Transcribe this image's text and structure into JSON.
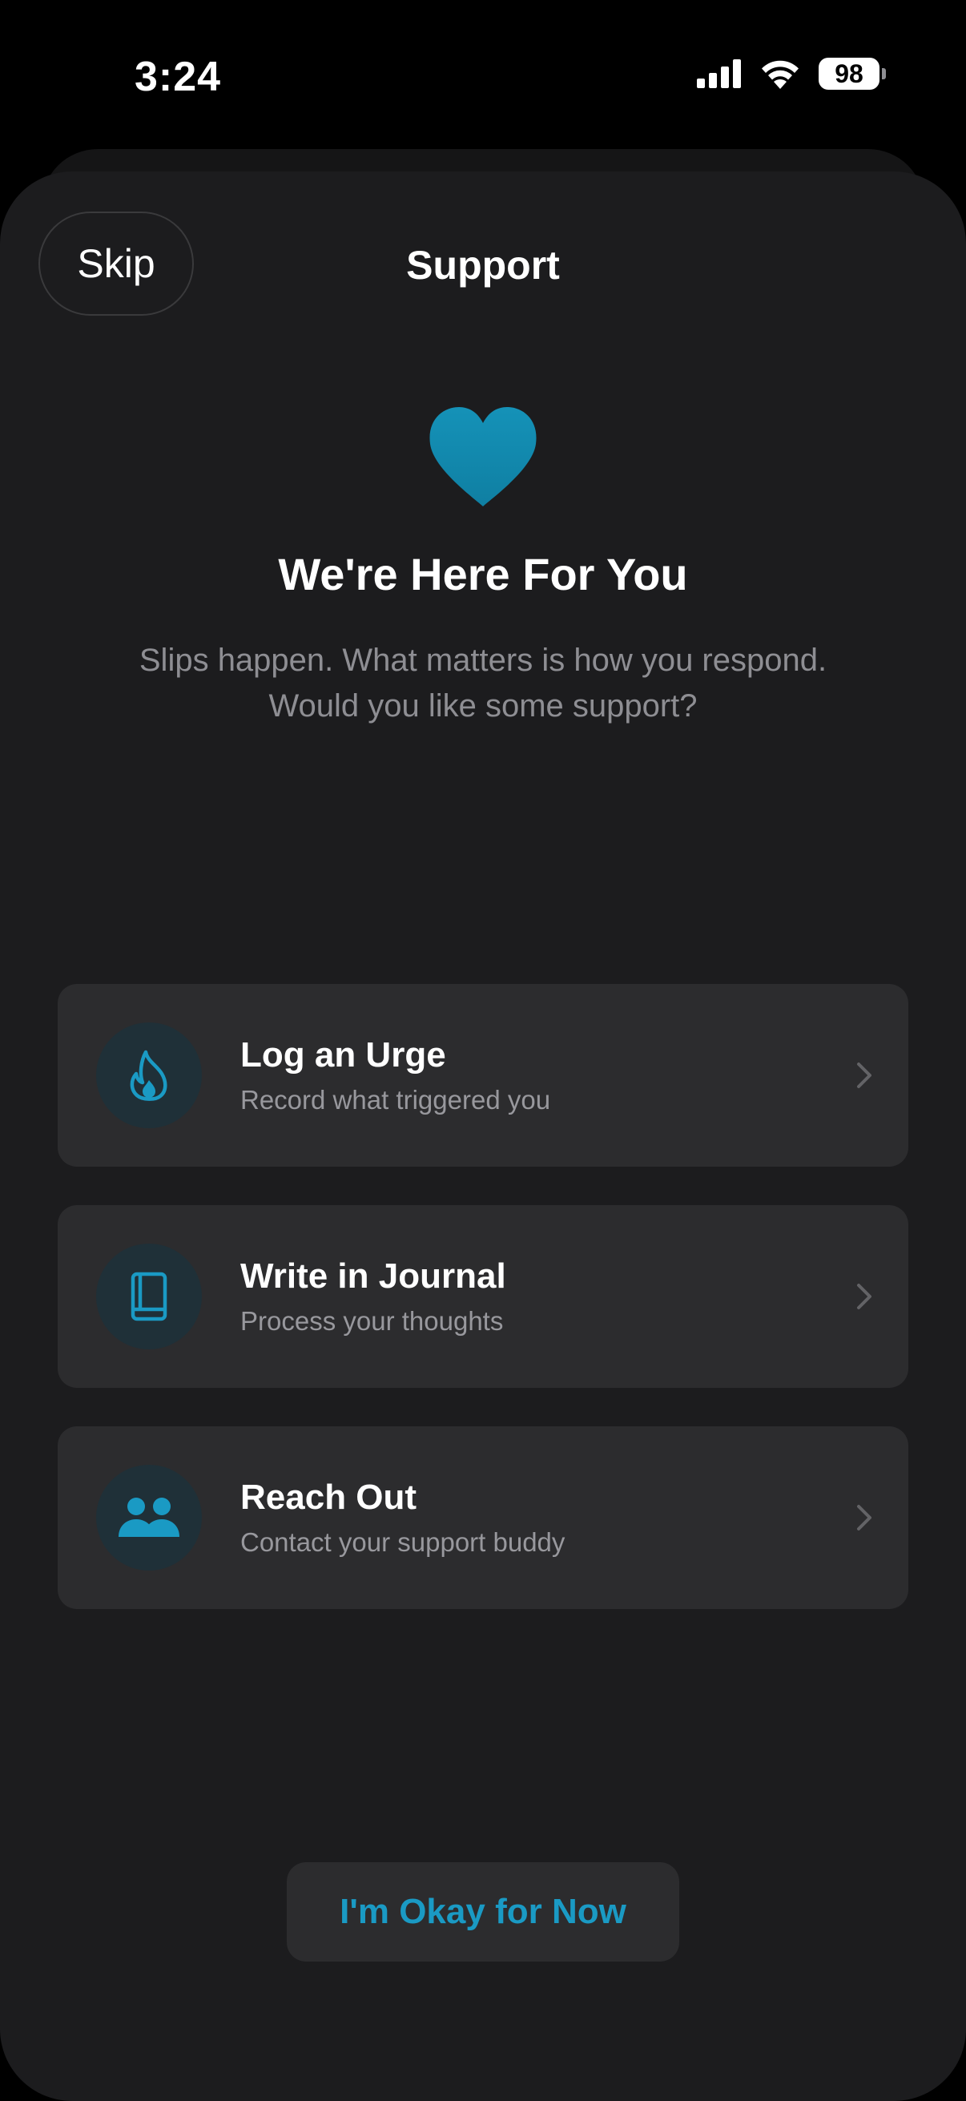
{
  "status_bar": {
    "time": "3:24",
    "battery": "98",
    "icons": [
      "signal-icon",
      "wifi-icon",
      "battery-icon"
    ]
  },
  "header": {
    "skip_label": "Skip",
    "title": "Support"
  },
  "hero": {
    "icon": "heart-icon",
    "headline": "We're Here For You",
    "subtext_line1": "Slips happen. What matters is how you respond.",
    "subtext_line2": "Would you like some support?"
  },
  "options": [
    {
      "icon": "flame-icon",
      "title": "Log an Urge",
      "subtitle": "Record what triggered you"
    },
    {
      "icon": "book-icon",
      "title": "Write in Journal",
      "subtitle": "Process your thoughts"
    },
    {
      "icon": "people-icon",
      "title": "Reach Out",
      "subtitle": "Contact your support buddy"
    }
  ],
  "footer": {
    "okay_label": "I'm Okay for Now"
  },
  "colors": {
    "accent": "#1a9ac4",
    "background": "#000000",
    "sheet": "#1c1c1e",
    "card": "#2c2c2e",
    "icon_circle": "#1f3038",
    "secondary_text": "#8e8e93"
  }
}
